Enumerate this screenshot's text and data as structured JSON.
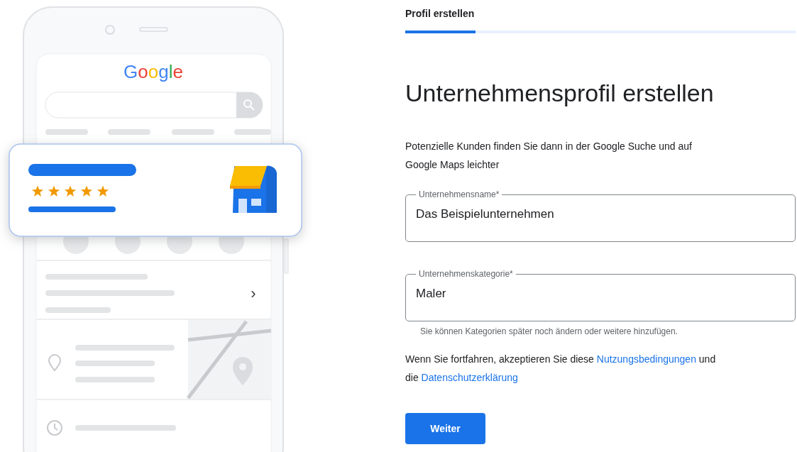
{
  "illustration": {
    "logo": "Google",
    "card": {
      "stars": 5
    },
    "chevron": "›"
  },
  "progress": {
    "step_label": "Profil erstellen",
    "level": 0.18
  },
  "heading": "Unternehmensprofil erstellen",
  "intro": "Potenzielle Kunden finden Sie dann in der Google Suche und auf Google Maps leichter",
  "fields": [
    {
      "label": "Unternehmensname*",
      "value": "Das Beispielunternehmen"
    },
    {
      "label": "Unternehmenskategorie*",
      "value": "Maler",
      "helper": "Sie können Kategorien später noch ändern oder weitere hinzufügen."
    }
  ],
  "terms": {
    "before": "Wenn Sie fortfahren, akzeptieren Sie diese ",
    "link_1": "Nutzungsbedingungen",
    "middle": " und die ",
    "link_2": "Datenschutzerklärung"
  },
  "button": "Weiter"
}
